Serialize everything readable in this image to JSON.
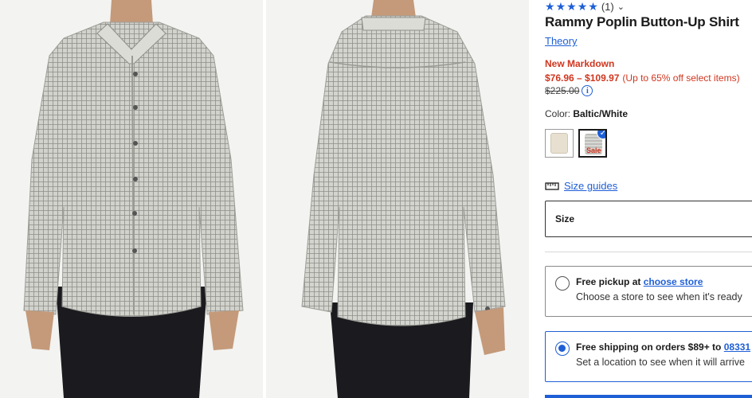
{
  "product": {
    "rating_stars": 5,
    "review_count": "(1)",
    "title": "Rammy Poplin Button-Up Shirt",
    "brand": "Theory",
    "markdown_label": "New Markdown",
    "price_range": "$76.96 – $109.97",
    "price_note": "(Up to 65% off select items)",
    "original_price": "$225.00",
    "color_label": "Color:",
    "color_value": "Baltic/White",
    "swatches": [
      {
        "name": "cream",
        "color": "#e7dfd0",
        "selected": false
      },
      {
        "name": "Baltic/White",
        "color": "#bdbdb9",
        "selected": true,
        "tag": "Sale"
      }
    ],
    "size_guides_label": "Size guides",
    "size_label": "Size"
  },
  "fulfillment": {
    "pickup": {
      "title": "Free pickup at ",
      "link": "choose store",
      "subtitle": "Choose a store to see when it's ready",
      "selected": false
    },
    "shipping": {
      "title": "Free shipping on orders $89+ to ",
      "link": "08331",
      "subtitle": "Set a location to see when it will arrive",
      "selected": true
    }
  },
  "colors": {
    "accent": "#1f5fd6",
    "sale": "#d0361f",
    "shirt": "#c9c9c4",
    "pants": "#1b1b1f"
  },
  "icons": [
    "star-icon",
    "chevron-down-icon",
    "info-icon",
    "checkmark-icon",
    "ruler-icon"
  ]
}
